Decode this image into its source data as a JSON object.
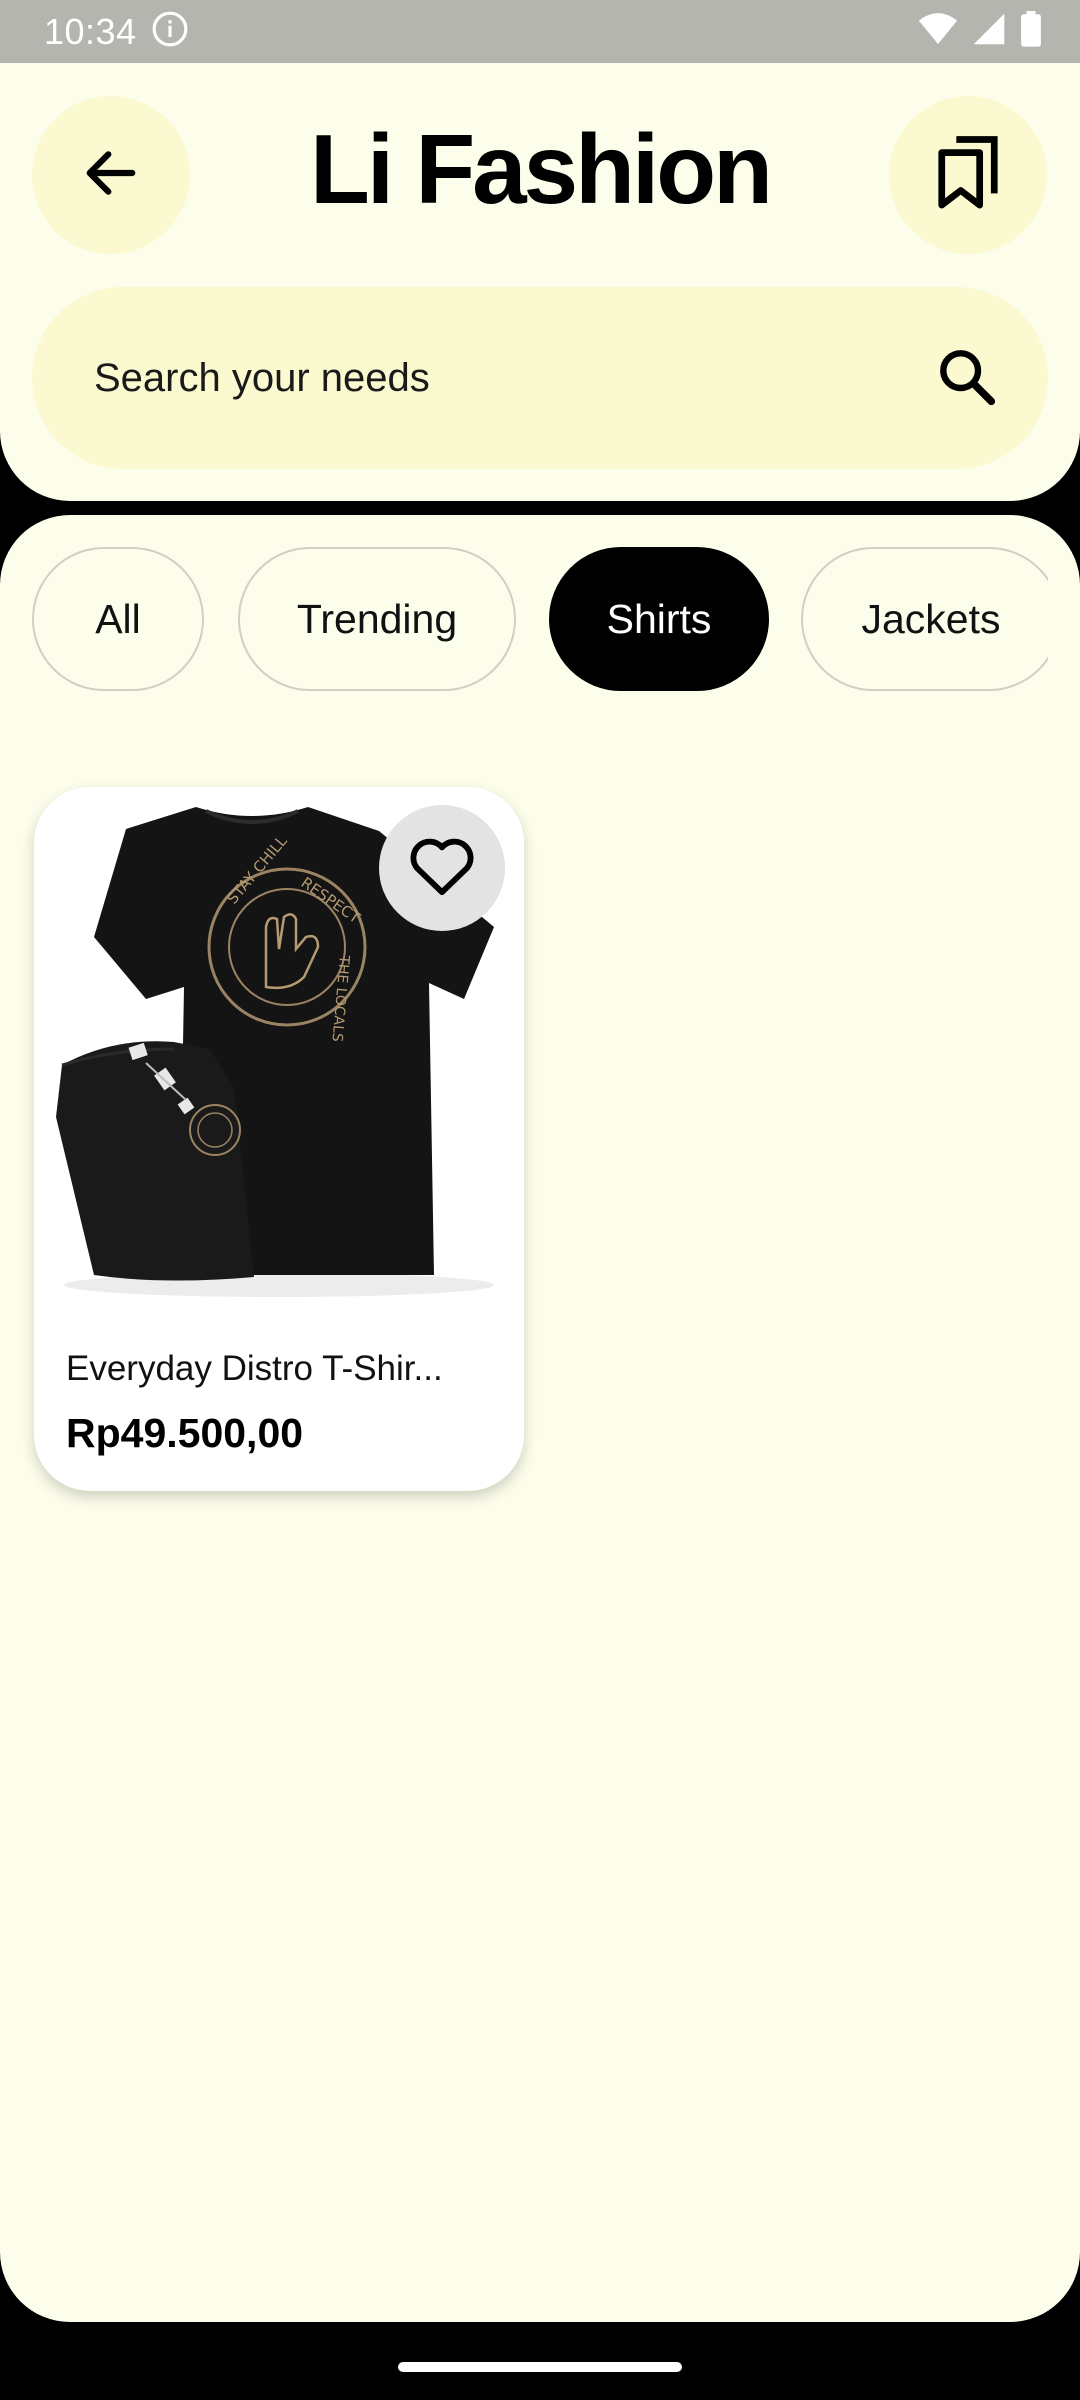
{
  "status_bar": {
    "time": "10:34"
  },
  "header": {
    "title": "Li Fashion"
  },
  "search": {
    "placeholder": "Search your needs"
  },
  "categories": [
    {
      "label": "All",
      "active": false
    },
    {
      "label": "Trending",
      "active": false
    },
    {
      "label": "Shirts",
      "active": true
    },
    {
      "label": "Jackets",
      "active": false
    }
  ],
  "products": [
    {
      "name": "Everyday Distro T-Shir...",
      "price": "Rp49.500,00",
      "print_text": [
        "STAY CHILL",
        "RESPECT",
        "THE LOCALS"
      ]
    }
  ],
  "colors": {
    "background": "#fdfdeb",
    "accent": "#fbf9cf",
    "active_chip": "#000000"
  },
  "icons": [
    "info-icon",
    "wifi-icon",
    "signal-icon",
    "battery-icon",
    "back-arrow-icon",
    "bookmarks-icon",
    "search-icon",
    "heart-icon"
  ]
}
